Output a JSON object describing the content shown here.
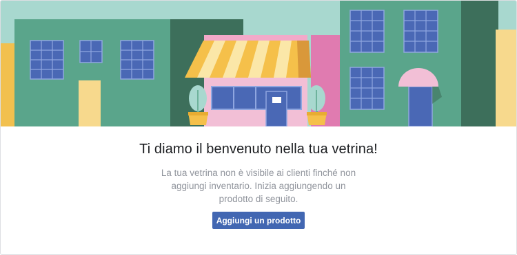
{
  "welcome": {
    "title": "Ti diamo il benvenuto nella tua vetrina!",
    "description": "La tua vetrina non è visibile ai clienti finché non aggiungi inventario. Inizia aggiungendo un prodotto di seguito.",
    "add_product_button": "Aggiungi un prodotto"
  },
  "colors": {
    "sky": "#a8d8cf",
    "building_green": "#5aa58b",
    "building_dark_green": "#3d6f5b",
    "shop_pink": "#f2bfd6",
    "awning_yellow": "#f5c04a",
    "window_blue": "#4a68b5",
    "door_yellow": "#f7d98d",
    "button_blue": "#4267b2"
  }
}
